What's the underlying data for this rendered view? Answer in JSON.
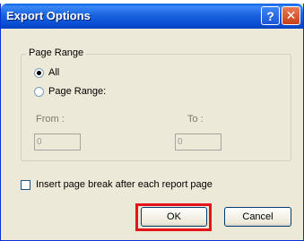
{
  "window": {
    "title": "Export Options",
    "help_glyph": "?",
    "close_glyph": "✕"
  },
  "page_range": {
    "legend": "Page Range",
    "option_all": "All",
    "option_range": "Page Range:",
    "selected": "All",
    "from_label": "From :",
    "to_label": "To :",
    "from_value": "0",
    "to_value": "0"
  },
  "options": {
    "page_break_label": "Insert page break after each report page",
    "page_break_checked": false
  },
  "buttons": {
    "ok": "OK",
    "cancel": "Cancel"
  },
  "colors": {
    "titlebar": "#0a4fd3",
    "dialog_bg": "#ece9d8",
    "highlight": "#e3151b"
  }
}
